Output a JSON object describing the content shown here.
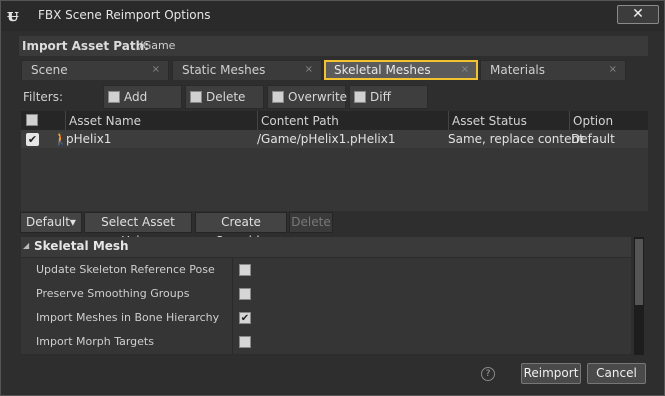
{
  "window": {
    "title": "FBX Scene Reimport Options",
    "close_glyph": "✕"
  },
  "import_path": {
    "label": "Import Asset Path:",
    "value": "/Game"
  },
  "tabs": [
    {
      "label": "Scene",
      "active": false
    },
    {
      "label": "Static Meshes",
      "active": false
    },
    {
      "label": "Skeletal Meshes",
      "active": true
    },
    {
      "label": "Materials",
      "active": false
    }
  ],
  "tab_close_glyph": "×",
  "filters": {
    "label": "Filters:",
    "options": [
      {
        "label": "Add",
        "checked": false
      },
      {
        "label": "Delete",
        "checked": false
      },
      {
        "label": "Overwrite",
        "checked": false
      },
      {
        "label": "Diff",
        "checked": false
      }
    ]
  },
  "asset_table": {
    "columns": [
      "Asset Name",
      "Content Path",
      "Asset Status",
      "Option Name"
    ],
    "rows": [
      {
        "checked": true,
        "asset_name": "pHelix1",
        "content_path": "/Game/pHelix1.pHelix1",
        "asset_status": "Same, replace content",
        "option_name": "Default"
      }
    ]
  },
  "toolbar": {
    "default_label": "Default",
    "select_asset_label": "Select Asset Using",
    "create_override_label": "Create Override",
    "delete_label": "Delete"
  },
  "details": {
    "category": "Skeletal Mesh",
    "properties": [
      {
        "label": "Update Skeleton Reference Pose",
        "checked": false
      },
      {
        "label": "Preserve Smoothing Groups",
        "checked": false
      },
      {
        "label": "Import Meshes in Bone Hierarchy",
        "checked": true
      },
      {
        "label": "Import Morph Targets",
        "checked": false
      }
    ]
  },
  "footer": {
    "help_glyph": "?",
    "reimport_label": "Reimport",
    "cancel_label": "Cancel"
  },
  "colors": {
    "active_tab_border": "#f2c230",
    "panel_bg": "#2e2e2e"
  }
}
